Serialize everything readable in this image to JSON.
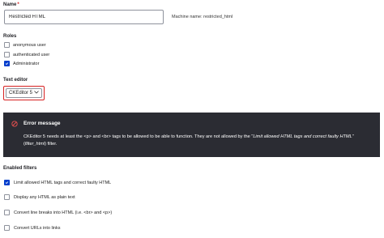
{
  "name_field": {
    "label": "Name",
    "required_marker": "*",
    "value": "Restricted HTML",
    "machine_name": "Machine name: restricted_html"
  },
  "roles": {
    "heading": "Roles",
    "items": [
      {
        "label": "anonymous user",
        "checked": false
      },
      {
        "label": "authenticated user",
        "checked": false
      },
      {
        "label": "Administrator",
        "checked": true
      }
    ]
  },
  "text_editor": {
    "label": "Text editor",
    "selected": "CKEditor 5"
  },
  "error": {
    "title": "Error message",
    "message_part1": "CKEditor 5 needs at least the <p> and <br> tags to be allowed to be able to function. They are not allowed by the \"",
    "message_emph": "Limit allowed HTML tags and correct faulty HTML",
    "message_part2": "\" (",
    "message_code": "filter_html",
    "message_part3": ") filter.",
    "accent_color": "#d72222",
    "background_color": "#2b2c33"
  },
  "filters": {
    "heading": "Enabled filters",
    "items": [
      {
        "label": "Limit allowed HTML tags and correct faulty HTML",
        "checked": true
      },
      {
        "label": "Display any HTML as plain text",
        "checked": false
      },
      {
        "label": "Convert line breaks into HTML (i.e. <br> and <p>)",
        "checked": false
      },
      {
        "label": "Convert URLs into links",
        "checked": false
      }
    ]
  },
  "colors": {
    "checkbox_checked": "#003ecc",
    "select_focus_border": "#d72222"
  }
}
